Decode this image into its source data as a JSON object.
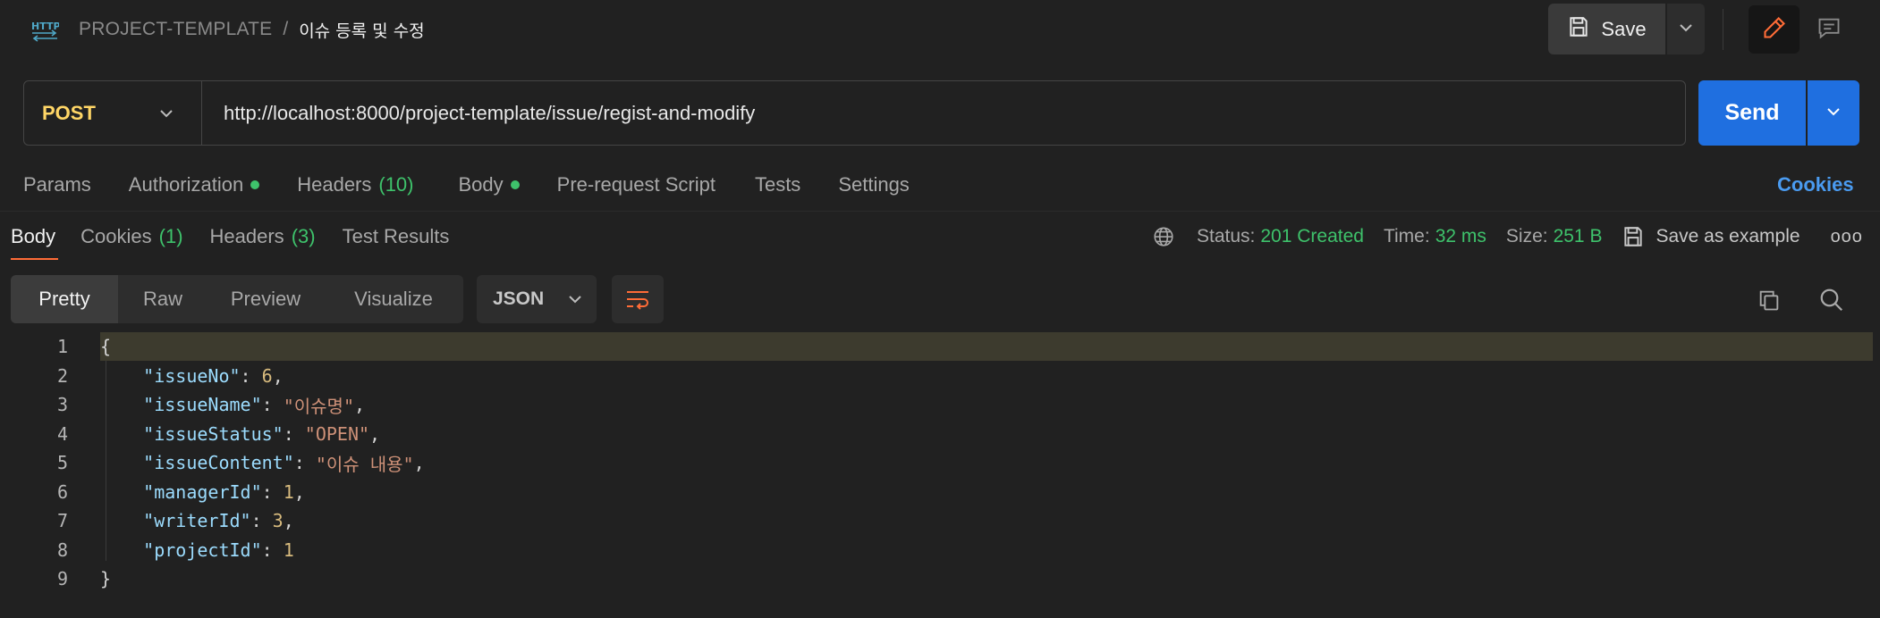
{
  "header": {
    "icon": "http-icon",
    "collection": "PROJECT-TEMPLATE",
    "separator": "/",
    "request_name": "이슈 등록 및 수정",
    "save_label": "Save"
  },
  "request": {
    "method": "POST",
    "url": "http://localhost:8000/project-template/issue/regist-and-modify",
    "send_label": "Send",
    "tabs": [
      {
        "label": "Params"
      },
      {
        "label": "Authorization",
        "dot": true
      },
      {
        "label": "Headers",
        "count": "(10)"
      },
      {
        "label": "Body",
        "dot": true
      },
      {
        "label": "Pre-request Script"
      },
      {
        "label": "Tests"
      },
      {
        "label": "Settings"
      }
    ],
    "cookies_label": "Cookies"
  },
  "response": {
    "tabs": [
      {
        "label": "Body"
      },
      {
        "label": "Cookies",
        "count": "(1)"
      },
      {
        "label": "Headers",
        "count": "(3)"
      },
      {
        "label": "Test Results"
      }
    ],
    "status_label": "Status:",
    "status_value": "201 Created",
    "time_label": "Time:",
    "time_value": "32 ms",
    "size_label": "Size:",
    "size_value": "251 B",
    "save_example_label": "Save as example",
    "more_label": "ooo",
    "views": [
      "Pretty",
      "Raw",
      "Preview",
      "Visualize"
    ],
    "format": "JSON",
    "body_lines": [
      {
        "no": "1",
        "parts": [
          {
            "t": "b",
            "v": "{"
          }
        ]
      },
      {
        "no": "2",
        "parts": [
          {
            "t": "k",
            "v": "    \"issueNo\""
          },
          {
            "t": "p",
            "v": ": "
          },
          {
            "t": "n",
            "v": "6"
          },
          {
            "t": "p",
            "v": ","
          }
        ]
      },
      {
        "no": "3",
        "parts": [
          {
            "t": "k",
            "v": "    \"issueName\""
          },
          {
            "t": "p",
            "v": ": "
          },
          {
            "t": "s",
            "v": "\"이슈명\""
          },
          {
            "t": "p",
            "v": ","
          }
        ]
      },
      {
        "no": "4",
        "parts": [
          {
            "t": "k",
            "v": "    \"issueStatus\""
          },
          {
            "t": "p",
            "v": ": "
          },
          {
            "t": "s",
            "v": "\"OPEN\""
          },
          {
            "t": "p",
            "v": ","
          }
        ]
      },
      {
        "no": "5",
        "parts": [
          {
            "t": "k",
            "v": "    \"issueContent\""
          },
          {
            "t": "p",
            "v": ": "
          },
          {
            "t": "s",
            "v": "\"이슈 내용\""
          },
          {
            "t": "p",
            "v": ","
          }
        ]
      },
      {
        "no": "6",
        "parts": [
          {
            "t": "k",
            "v": "    \"managerId\""
          },
          {
            "t": "p",
            "v": ": "
          },
          {
            "t": "n",
            "v": "1"
          },
          {
            "t": "p",
            "v": ","
          }
        ]
      },
      {
        "no": "7",
        "parts": [
          {
            "t": "k",
            "v": "    \"writerId\""
          },
          {
            "t": "p",
            "v": ": "
          },
          {
            "t": "n",
            "v": "3"
          },
          {
            "t": "p",
            "v": ","
          }
        ]
      },
      {
        "no": "8",
        "parts": [
          {
            "t": "k",
            "v": "    \"projectId\""
          },
          {
            "t": "p",
            "v": ": "
          },
          {
            "t": "n",
            "v": "1"
          }
        ]
      },
      {
        "no": "9",
        "parts": [
          {
            "t": "b",
            "v": "}"
          }
        ]
      }
    ]
  },
  "colors": {
    "accent": "#ff6c37",
    "send": "#1f6fe0",
    "method": "#ffd666",
    "success": "#3ec26b",
    "link": "#4a9bf0"
  }
}
